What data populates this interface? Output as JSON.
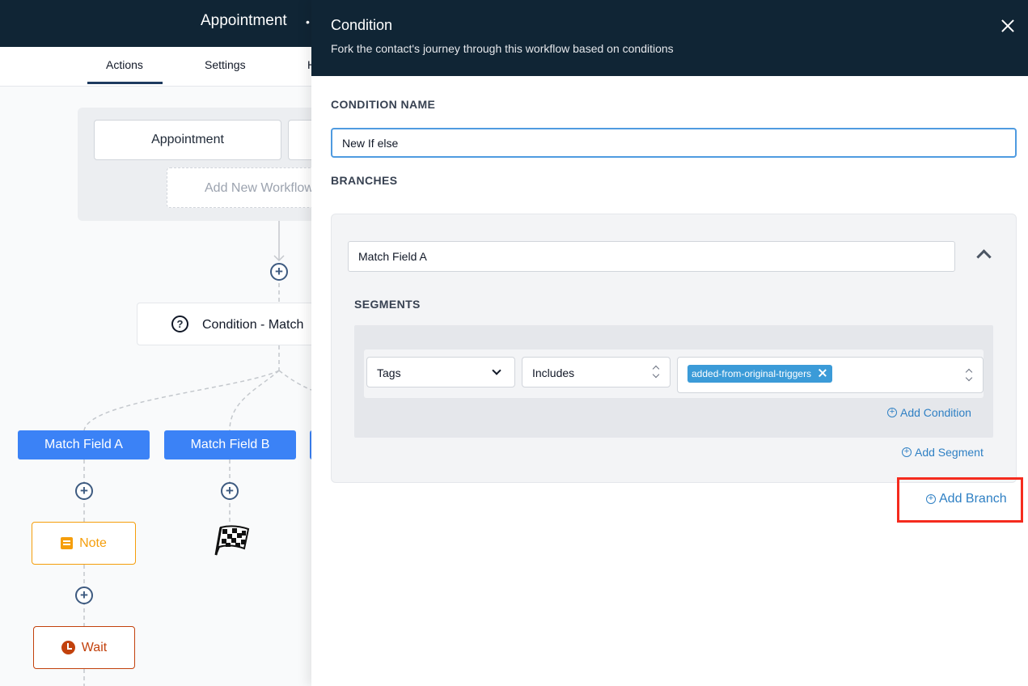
{
  "workflow": {
    "title": "Appointment",
    "title_tail": "•",
    "tabs": [
      {
        "label": "Actions",
        "active": true
      },
      {
        "label": "Settings",
        "active": false
      },
      {
        "label": "H",
        "active": false
      }
    ],
    "triggers": [
      "Appointment",
      ""
    ],
    "add_trigger_label": "Add New Workflow",
    "condition_node_label": "Condition - Match",
    "branches": [
      "Match Field A",
      "Match Field B",
      ""
    ],
    "actions": {
      "note": "Note",
      "wait": "Wait"
    },
    "icons": [
      "plus-icon",
      "question-icon",
      "note-icon",
      "clock-icon",
      "finish-flag-icon"
    ]
  },
  "drawer": {
    "title": "Condition",
    "subtitle": "Fork the contact's journey through this workflow based on conditions",
    "condition_name_label": "CONDITION NAME",
    "condition_name_value": "New If else",
    "branches_label": "BRANCHES",
    "branch": {
      "name": "Match Field A",
      "segments_label": "SEGMENTS",
      "condition": {
        "field": "Tags",
        "operator": "Includes",
        "values": [
          "added-from-original-triggers"
        ]
      },
      "add_condition_label": "Add Condition",
      "add_segment_label": "Add Segment"
    },
    "add_branch_label": "Add Branch"
  },
  "colors": {
    "header_bg": "#102535",
    "branch_button": "#3b82f6",
    "link": "#2f80c4",
    "highlight": "#f52b1e",
    "note_accent": "#f59e0b",
    "wait_accent": "#c2410c"
  }
}
